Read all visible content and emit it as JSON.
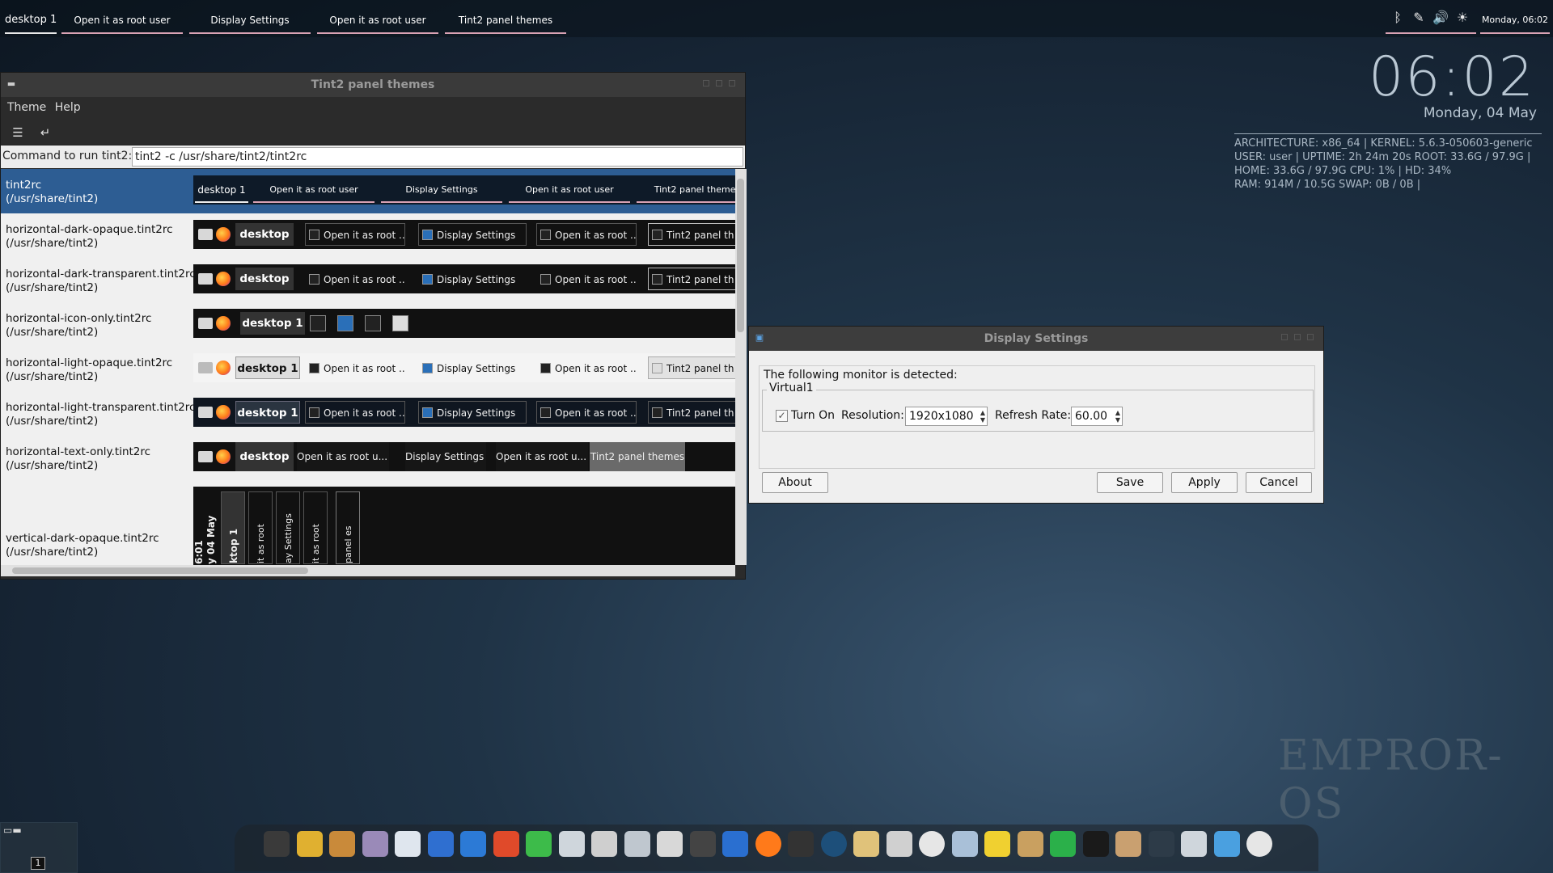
{
  "top_panel": {
    "desktop": "desktop 1",
    "tasks": [
      "Open it as  root user",
      "Display Settings",
      "Open it as  root user",
      "Tint2 panel themes"
    ],
    "clock": "Monday, 06:02",
    "tray_icons": [
      "bluetooth-icon",
      "network-icon",
      "volume-icon",
      "weather-icon"
    ]
  },
  "conky": {
    "time": "06:02",
    "date": "Monday, 04 May",
    "line1": "ARCHITECTURE: x86_64 | KERNEL: 5.6.3-050603-generic",
    "line2": "USER: user | UPTIME: 2h 24m 20s   ROOT: 33.6G / 97.9G |",
    "line3": "HOME: 33.6G / 97.9G   CPU: 1% |   HD: 34%",
    "line4": "RAM: 914M / 10.5G  SWAP: 0B / 0B |",
    "logo": "EMPROR-OS"
  },
  "tint2_window": {
    "title": "Tint2 panel themes",
    "menu": [
      "Theme",
      "Help"
    ],
    "cmd_label": "Command to run tint2:",
    "cmd_value": "tint2 -c /usr/share/tint2/tint2rc",
    "themes": [
      {
        "name": "tint2rc",
        "path": "(/usr/share/tint2)"
      },
      {
        "name": "horizontal-dark-opaque.tint2rc",
        "path": "(/usr/share/tint2)"
      },
      {
        "name": "horizontal-dark-transparent.tint2rc",
        "path": "(/usr/share/tint2)"
      },
      {
        "name": "horizontal-icon-only.tint2rc",
        "path": "(/usr/share/tint2)"
      },
      {
        "name": "horizontal-light-opaque.tint2rc",
        "path": "(/usr/share/tint2)"
      },
      {
        "name": "horizontal-light-transparent.tint2rc",
        "path": "(/usr/share/tint2)"
      },
      {
        "name": "horizontal-text-only.tint2rc",
        "path": "(/usr/share/tint2)"
      },
      {
        "name": "vertical-dark-opaque.tint2rc",
        "path": "(/usr/share/tint2)"
      }
    ],
    "preview": {
      "desktop": "desktop 1",
      "task_open": "Open it as  root user",
      "task_open_short": "Open it as  root ...",
      "task_open_text": "Open it as  root u...",
      "task_display": "Display Settings",
      "task_tint2": "Tint2 panel themes",
      "task_tint2_short": "Tint2 panel th",
      "vertical": [
        "6:01",
        "y 04 May",
        "ktop 1",
        "it as  root",
        "ay Settings",
        "it as  root",
        "panel es"
      ]
    }
  },
  "display_window": {
    "title": "Display Settings",
    "detected": "The following monitor is detected:",
    "monitor": "Virtual1",
    "turn_on_label": "Turn On",
    "turn_on_checked": true,
    "resolution_label": "Resolution:",
    "resolution": "1920x1080",
    "refresh_label": "Refresh Rate:",
    "refresh": "60.00",
    "buttons": {
      "about": "About",
      "save": "Save",
      "apply": "Apply",
      "cancel": "Cancel"
    }
  },
  "workspace": {
    "number": "1"
  },
  "dock_icons": [
    "terminal-icon",
    "pet-icon",
    "archive-icon",
    "geany-icon",
    "document-viewer-icon",
    "writer-icon",
    "vscode-icon",
    "office-icon",
    "qt-icon",
    "printer-icon",
    "camera-icon",
    "phone-icon",
    "remote-icon",
    "monitor-app-icon",
    "bluetooth-icon",
    "firefox-icon",
    "media-player-icon",
    "compass-icon",
    "files-icon",
    "drive-icon",
    "disc-icon",
    "scanner-icon",
    "editor-icon",
    "package-icon",
    "sync-icon",
    "system-monitor-icon",
    "boxes-icon",
    "display-icon",
    "screenshot-icon",
    "folder-icon",
    "power-icon"
  ]
}
